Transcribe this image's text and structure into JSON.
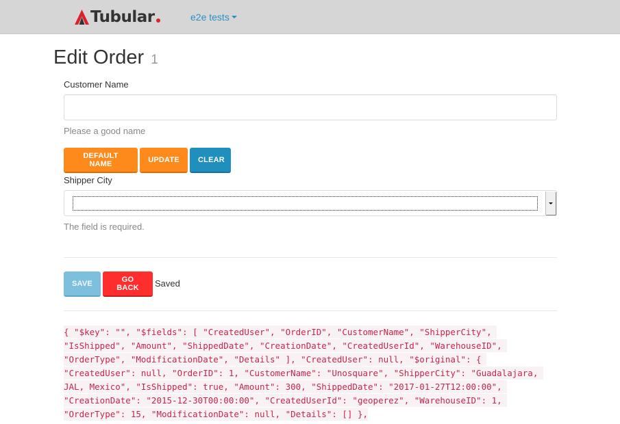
{
  "navbar": {
    "brand": "Tubular",
    "menu_label": "e2e tests"
  },
  "page": {
    "title": "Edit Order",
    "order_id": "1"
  },
  "form": {
    "customer_name": {
      "label": "Customer Name",
      "value": "",
      "help": "Please a good name"
    },
    "buttons": {
      "default_name": "Default Name",
      "update": "Update",
      "clear": "Clear"
    },
    "shipper_city": {
      "label": "Shipper City",
      "value": "",
      "help": "The field is required."
    },
    "actions": {
      "save": "Save",
      "go_back": "Go Back",
      "status": "Saved"
    }
  },
  "debug_json": "{ \"$key\": \"\", \"$fields\": [ \"CreatedUser\", \"OrderID\", \"CustomerName\", \"ShipperCity\", \"IsShipped\", \"Amount\", \"ShippedDate\", \"CreationDate\", \"CreatedUserId\", \"WarehouseID\", \"OrderType\", \"ModificationDate\", \"Details\" ], \"CreatedUser\": null, \"$original\": { \"CreatedUser\": null, \"OrderID\": 1, \"CustomerName\": \"Unosquare\", \"ShipperCity\": \"Guadalajara, JAL, Mexico\", \"IsShipped\": true, \"Amount\": 300, \"ShippedDate\": \"2017-01-27T12:00:00\", \"CreationDate\": \"2015-12-30T00:00:00\", \"CreatedUserId\": \"geoperez\", \"WarehouseID\": 1, \"OrderType\": 15, \"ModificationDate\": null, \"Details\": [] },",
  "colors": {
    "navbar_bg": "#d6d6d6",
    "brand_red": "#d9222a",
    "link_blue": "#2a8fc4",
    "btn_orange": "#ff8a1c",
    "btn_blue": "#1f8fbd",
    "btn_red": "#ff2e2e",
    "btn_save_disabled": "#7dbfdc",
    "code_text": "#c7254e",
    "code_bg": "#f9f2f4"
  },
  "icons": {
    "brand_logo": "tubular-logo-icon",
    "menu_caret": "caret-down-icon",
    "select_arrow": "select-arrow-icon"
  }
}
